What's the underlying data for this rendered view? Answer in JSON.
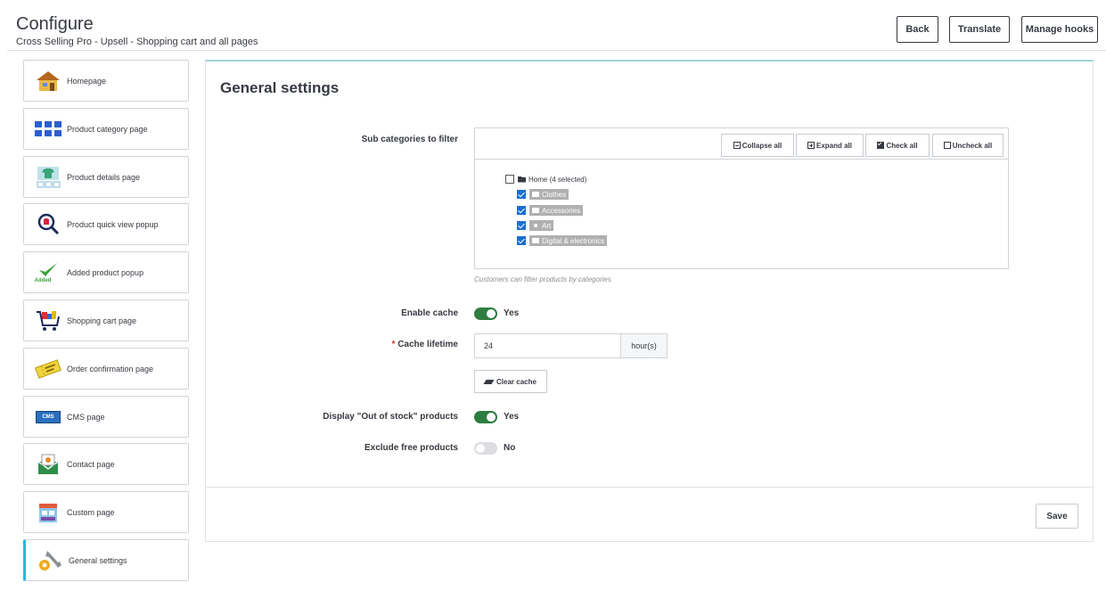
{
  "header": {
    "title": "Configure",
    "subtitle": "Cross Selling Pro - Upsell - Shopping cart and all pages",
    "buttons": {
      "back": "Back",
      "translate": "Translate",
      "manage_hooks": "Manage hooks"
    }
  },
  "sidebar": {
    "items": [
      {
        "label": "Homepage",
        "icon": "house-icon"
      },
      {
        "label": "Product category page",
        "icon": "grid-icon"
      },
      {
        "label": "Product details page",
        "icon": "tshirt-icon"
      },
      {
        "label": "Product quick view popup",
        "icon": "magnifier-icon"
      },
      {
        "label": "Added product popup",
        "icon": "checkmark-icon",
        "icon_text": "Added"
      },
      {
        "label": "Shopping cart page",
        "icon": "cart-icon"
      },
      {
        "label": "Order confirmation page",
        "icon": "ticket-icon"
      },
      {
        "label": "CMS page",
        "icon": "cms-icon",
        "icon_text": "CMS"
      },
      {
        "label": "Contact page",
        "icon": "envelope-icon"
      },
      {
        "label": "Custom page",
        "icon": "storefront-icon"
      },
      {
        "label": "General settings",
        "icon": "wrench-gear-icon",
        "active": true
      }
    ]
  },
  "panel": {
    "title": "General settings",
    "subcategories": {
      "label": "Sub categories to filter",
      "toolbar": {
        "collapse": "Collapse all",
        "expand": "Expand all",
        "check": "Check all",
        "uncheck": "Uncheck all"
      },
      "root": {
        "label": "Home (4 selected)",
        "checked": false
      },
      "children": [
        {
          "label": "Clothes",
          "checked": true
        },
        {
          "label": "Accessories",
          "checked": true
        },
        {
          "label": "Art",
          "checked": true
        },
        {
          "label": "Digital & electronics",
          "checked": true
        }
      ],
      "help": "Customers can filter products by categories"
    },
    "enable_cache": {
      "label": "Enable cache",
      "value": "Yes",
      "on": true
    },
    "cache_lifetime": {
      "label": "Cache lifetime",
      "required": "*",
      "value": "24",
      "unit": "hour(s)"
    },
    "clear_cache": "Clear cache",
    "out_of_stock": {
      "label": "Display \"Out of stock\" products",
      "value": "Yes",
      "on": true
    },
    "exclude_free": {
      "label": "Exclude free products",
      "value": "No",
      "on": false
    },
    "save": "Save"
  },
  "colors": {
    "switch_on": "#2e7d3f",
    "accent": "#25b9d7",
    "checkbox": "#1b6fd1"
  }
}
